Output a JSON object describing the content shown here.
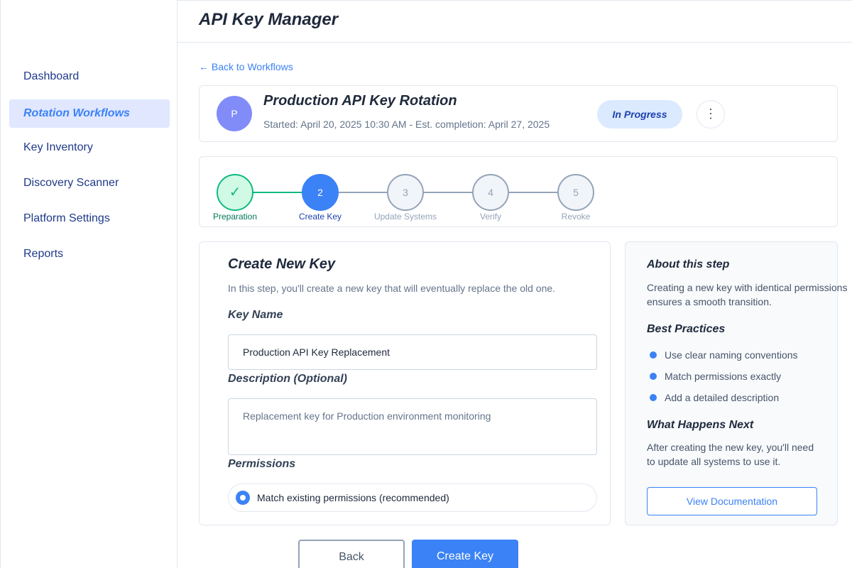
{
  "app": {
    "title": "API Key Manager"
  },
  "sidebar": {
    "items": [
      {
        "label": "Dashboard",
        "active": false
      },
      {
        "label": "Rotation Workflows",
        "active": true
      },
      {
        "label": "Key Inventory",
        "active": false
      },
      {
        "label": "Discovery Scanner",
        "active": false
      },
      {
        "label": "Platform Settings",
        "active": false
      },
      {
        "label": "Reports",
        "active": false
      }
    ]
  },
  "nav": {
    "back_link": "← Back to Workflows"
  },
  "workflow": {
    "avatar_letter": "P",
    "title": "Production API Key Rotation",
    "meta": "Started: April 20, 2025 10:30 AM - Est. completion: April 27, 2025",
    "status": "In Progress",
    "more_icon": "more-vertical-icon",
    "more_glyph": "⋮"
  },
  "steps": [
    {
      "number": "✓",
      "label": "Preparation",
      "state": "done"
    },
    {
      "number": "2",
      "label": "Create Key",
      "state": "current"
    },
    {
      "number": "3",
      "label": "Update Systems",
      "state": "pending"
    },
    {
      "number": "4",
      "label": "Verify",
      "state": "pending"
    },
    {
      "number": "5",
      "label": "Revoke",
      "state": "pending"
    }
  ],
  "form": {
    "title": "Create New Key",
    "description": "In this step, you'll create a new key that will eventually replace the old one.",
    "key_name_label": "Key Name",
    "key_name_value": "Production API Key Replacement",
    "description_label": "Description (Optional)",
    "description_value": "Replacement key for Production environment monitoring",
    "permissions_label": "Permissions",
    "permissions_option": "Match existing permissions (recommended)"
  },
  "info": {
    "about_title": "About this step",
    "about_text": "Creating a new key with identical permissions ensures a smooth transition.",
    "best_practices_title": "Best Practices",
    "best_practices": [
      "Use clear naming conventions",
      "Match permissions exactly",
      "Add a detailed description"
    ],
    "next_title": "What Happens Next",
    "next_text": "After creating the new key, you'll need to update all systems to use it.",
    "doc_button": "View Documentation"
  },
  "actions": {
    "back": "Back",
    "create": "Create Key"
  },
  "colors": {
    "accent": "#3b82f6",
    "success": "#10b981",
    "muted": "#94a3b8"
  }
}
